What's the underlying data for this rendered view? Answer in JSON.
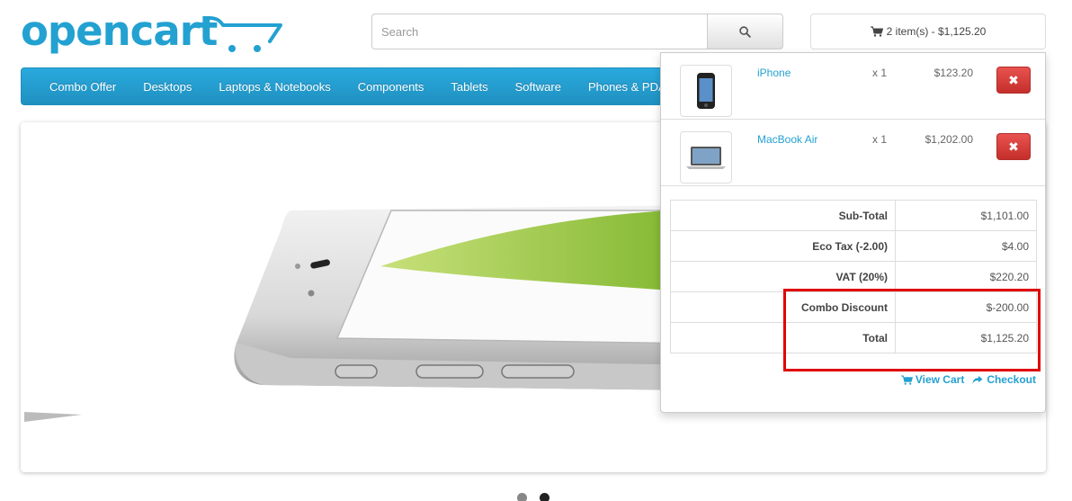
{
  "header": {
    "logo_text": "opencart",
    "search": {
      "placeholder": "Search"
    },
    "cart_button_label": "2 item(s) - $1,125.20"
  },
  "menu": {
    "items": [
      "Combo Offer",
      "Desktops",
      "Laptops & Notebooks",
      "Components",
      "Tablets",
      "Software",
      "Phones & PDAs"
    ]
  },
  "cart_dropdown": {
    "products": [
      {
        "name": "iPhone",
        "qty": "x 1",
        "price": "$123.20",
        "remove_icon": "times-icon"
      },
      {
        "name": "MacBook Air",
        "qty": "x 1",
        "price": "$1,202.00",
        "remove_icon": "times-icon"
      }
    ],
    "totals": [
      {
        "label": "Sub-Total",
        "value": "$1,101.00"
      },
      {
        "label": "Eco Tax (-2.00)",
        "value": "$4.00"
      },
      {
        "label": "VAT (20%)",
        "value": "$220.20"
      },
      {
        "label": "Combo Discount",
        "value": "$-200.00"
      },
      {
        "label": "Total",
        "value": "$1,125.20"
      }
    ],
    "view_cart_label": "View Cart",
    "checkout_label": "Checkout"
  },
  "colors": {
    "brand": "#23a1d1",
    "menu_bg": "#229ac8",
    "remove_button": "#d9534f",
    "highlight": "#e00000"
  },
  "slideshow": {
    "pager_count": 2,
    "active_index": 1
  }
}
